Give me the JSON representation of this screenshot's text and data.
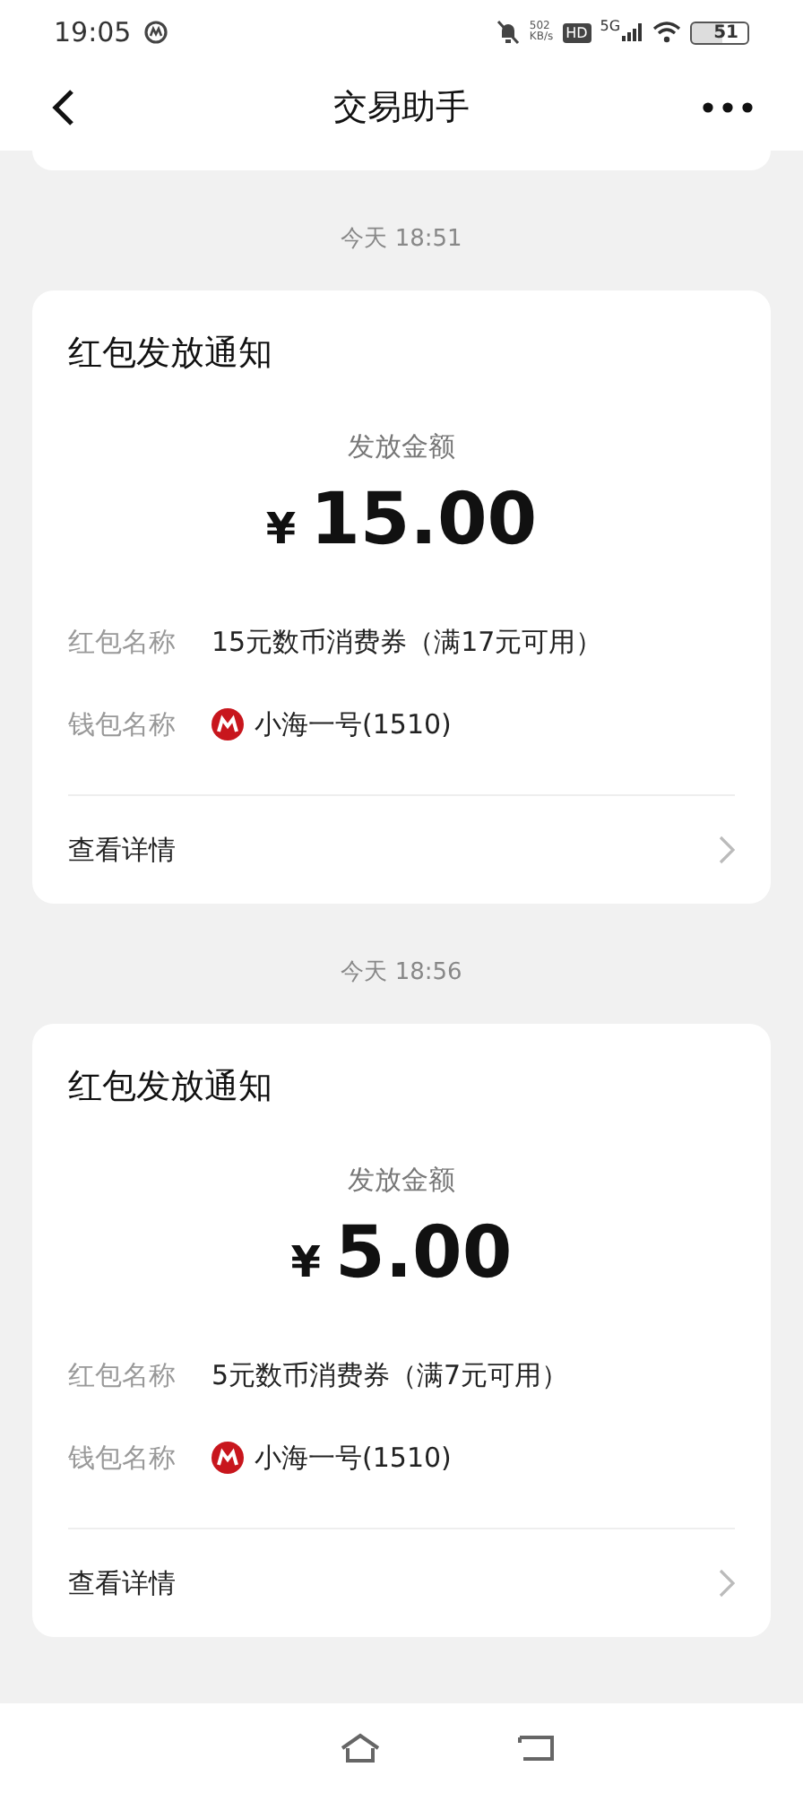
{
  "status_bar": {
    "time": "19:05",
    "net_speed": "502",
    "net_unit": "KB/s",
    "hd": "HD",
    "network": "5G",
    "battery": "51"
  },
  "header": {
    "title": "交易助手"
  },
  "messages": [
    {
      "time": "今天 18:51",
      "title": "红包发放通知",
      "amount_label": "发放金额",
      "currency": "¥",
      "amount": "15.00",
      "fields": [
        {
          "label": "红包名称",
          "value": "15元数币消费券（满17元可用）",
          "kind": "text"
        },
        {
          "label": "钱包名称",
          "value": "小海一号(1510)",
          "kind": "wallet"
        }
      ],
      "link": "查看详情"
    },
    {
      "time": "今天 18:56",
      "title": "红包发放通知",
      "amount_label": "发放金额",
      "currency": "¥",
      "amount": "5.00",
      "fields": [
        {
          "label": "红包名称",
          "value": "5元数币消费券（满7元可用）",
          "kind": "text"
        },
        {
          "label": "钱包名称",
          "value": "小海一号(1510)",
          "kind": "wallet"
        }
      ],
      "link": "查看详情"
    }
  ]
}
